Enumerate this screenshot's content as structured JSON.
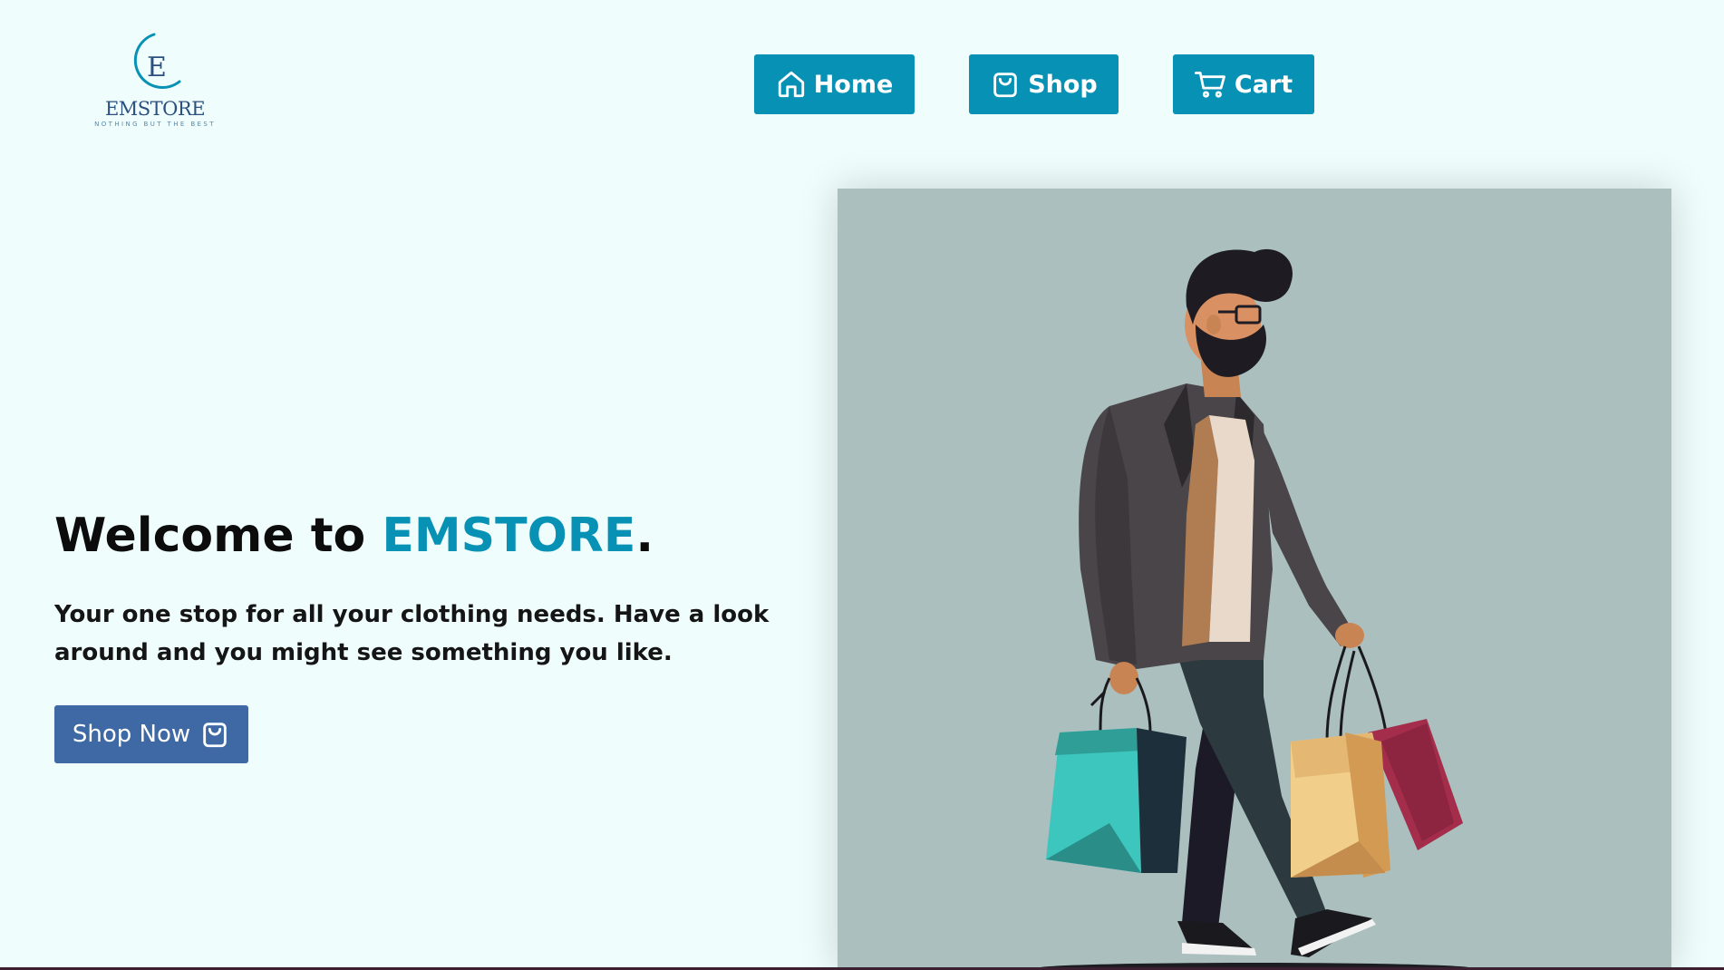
{
  "logo": {
    "letter": "E",
    "name": "EMSTORE",
    "tagline": "NOTHING BUT THE BEST"
  },
  "nav": {
    "home_label": "Home",
    "shop_label": "Shop",
    "cart_label": "Cart"
  },
  "hero": {
    "title_prefix": "Welcome to ",
    "title_brand": "EMSTORE",
    "title_suffix": ".",
    "subtitle": "Your one stop for all your clothing needs. Have a look around and you might see something you like.",
    "cta_label": "Shop Now"
  },
  "icons": {
    "home": "home-icon",
    "shop": "shopping-bag-icon",
    "cart": "cart-icon",
    "cta": "shopping-bag-icon"
  },
  "colors": {
    "background": "#effefd",
    "accent": "#0791b4",
    "cta": "#3e69a5",
    "image_background": "#abbfbe",
    "text": "#0c0c0c"
  }
}
